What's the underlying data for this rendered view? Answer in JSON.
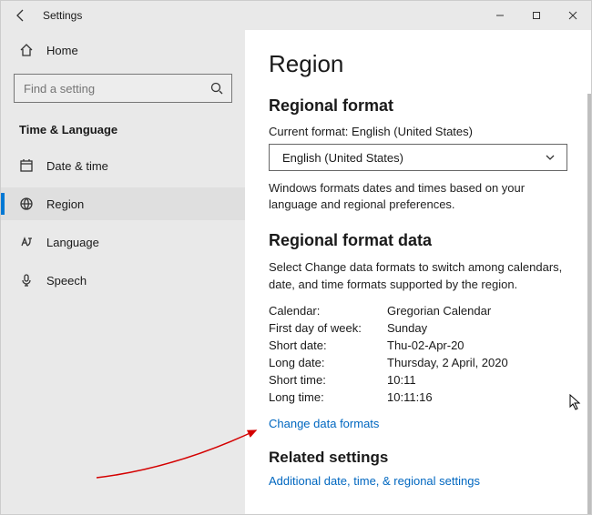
{
  "window": {
    "title": "Settings"
  },
  "sidebar": {
    "home": "Home",
    "search_placeholder": "Find a setting",
    "section": "Time & Language",
    "items": [
      {
        "label": "Date & time"
      },
      {
        "label": "Region"
      },
      {
        "label": "Language"
      },
      {
        "label": "Speech"
      }
    ]
  },
  "page": {
    "title": "Region",
    "format_heading": "Regional format",
    "current_format_label": "Current format: English (United States)",
    "dropdown_value": "English (United States)",
    "format_desc": "Windows formats dates and times based on your language and regional preferences.",
    "data_heading": "Regional format data",
    "data_desc": "Select Change data formats to switch among calendars, date, and time formats supported by the region.",
    "rows": {
      "calendar_k": "Calendar:",
      "calendar_v": "Gregorian Calendar",
      "firstday_k": "First day of week:",
      "firstday_v": "Sunday",
      "shortdate_k": "Short date:",
      "shortdate_v": "Thu-02-Apr-20",
      "longdate_k": "Long date:",
      "longdate_v": "Thursday, 2 April, 2020",
      "shorttime_k": "Short time:",
      "shorttime_v": "10:11",
      "longtime_k": "Long time:",
      "longtime_v": "10:11:16"
    },
    "change_link": "Change data formats",
    "related_heading": "Related settings",
    "related_link": "Additional date, time, & regional settings"
  }
}
